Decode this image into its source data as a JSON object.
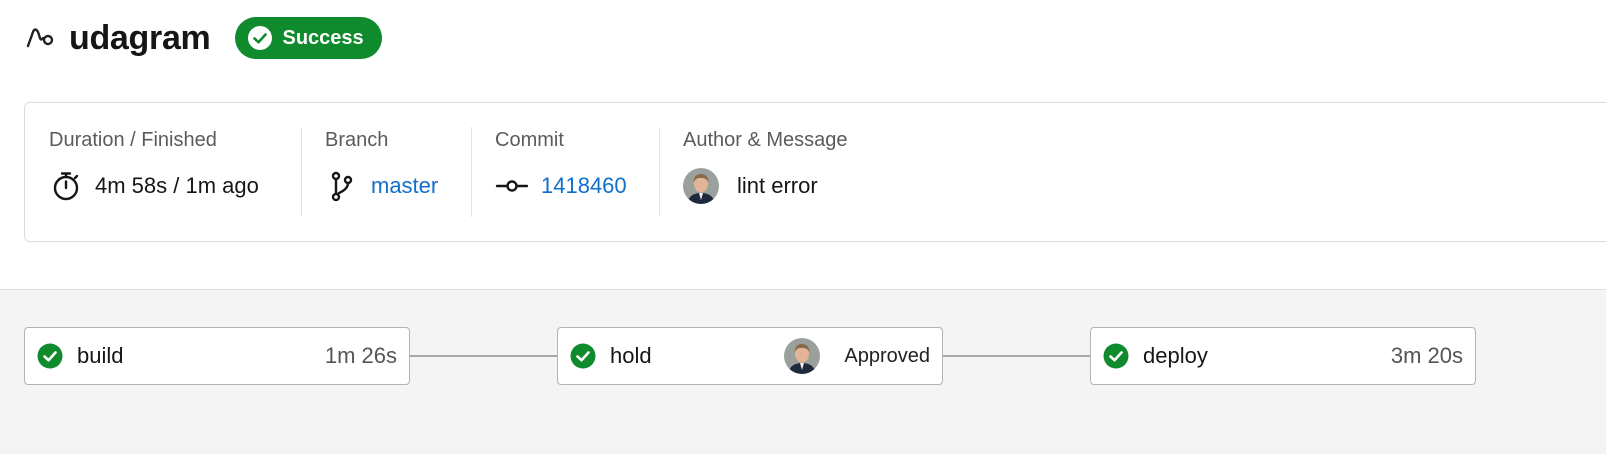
{
  "header": {
    "title": "udagram",
    "status": "Success",
    "project_icon": "pipeline-icon",
    "status_color": "#0f8a2c"
  },
  "info": {
    "duration": {
      "label": "Duration / Finished",
      "value": "4m 58s / 1m ago",
      "icon": "stopwatch-icon"
    },
    "branch": {
      "label": "Branch",
      "value": "master",
      "icon": "branch-icon"
    },
    "commit": {
      "label": "Commit",
      "value": "1418460",
      "icon": "commit-icon"
    },
    "author": {
      "label": "Author & Message",
      "message": "lint error",
      "icon": "avatar"
    }
  },
  "workflow": {
    "jobs": [
      {
        "name": "build",
        "status": "success",
        "meta": "1m 26s"
      },
      {
        "name": "hold",
        "status": "success",
        "meta": "Approved"
      },
      {
        "name": "deploy",
        "status": "success",
        "meta": "3m 20s"
      }
    ]
  },
  "colors": {
    "link": "#0f6fcf",
    "success": "#0f8a2c",
    "workflow_bg": "#f4f4f4"
  }
}
